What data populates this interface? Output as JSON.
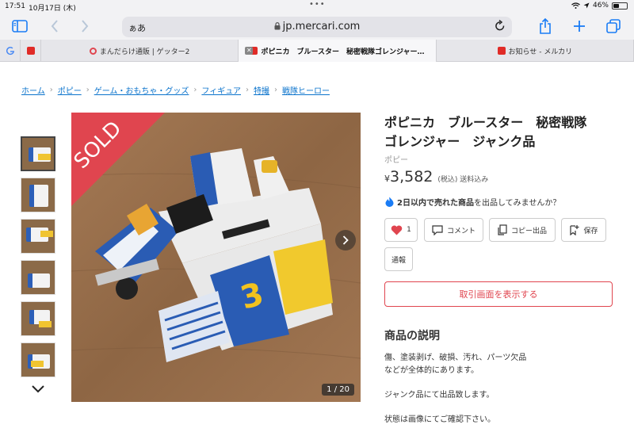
{
  "status_bar": {
    "time": "17:51",
    "date": "10月17日 (木)",
    "battery": "46%",
    "battery_level": 0.46
  },
  "toolbar": {
    "text_size": "ぁあ",
    "url": "jp.mercari.com"
  },
  "tabs": [
    {
      "label": "まんだらけ通販 | ゲッター2",
      "active": false
    },
    {
      "label": "ポピニカ　ブルースター　秘密戦隊ゴレンジャー…",
      "active": true
    },
    {
      "label": "お知らせ - メルカリ",
      "active": false
    }
  ],
  "breadcrumb": [
    "ホーム",
    "ポピー",
    "ゲーム・おもちゃ・グッズ",
    "フィギュア",
    "特撮",
    "戦隊ヒーロー"
  ],
  "gallery": {
    "sold_label": "SOLD",
    "counter": "1 / 20",
    "thumb_count": 6
  },
  "product": {
    "title_line1": "ポピニカ　ブルースター　秘密戦隊",
    "title_line2": "ゴレンジャー　ジャンク品",
    "brand": "ポピー",
    "price_symbol": "¥",
    "price": "3,582",
    "price_note": "(税込) 送料込み",
    "promo_bold": "2日以内で売れた商品",
    "promo_rest": "を出品してみませんか？"
  },
  "actions": {
    "like_count": "1",
    "comment": "コメント",
    "copy_listing": "コピー出品",
    "save": "保存",
    "report": "通報",
    "cta": "取引画面を表示する"
  },
  "description": {
    "heading": "商品の説明",
    "p1_line1": "傷、塗装剥げ、破損、汚れ、パーツ欠品",
    "p1_line2": "などが全体的にあります。",
    "p2": "ジャンク品にて出品致します。",
    "p3": "状態は画像にてご確認下さい。"
  },
  "colors": {
    "accent": "#1a7cf5",
    "mercari_red": "#e0454f",
    "link": "#0a73cc"
  }
}
